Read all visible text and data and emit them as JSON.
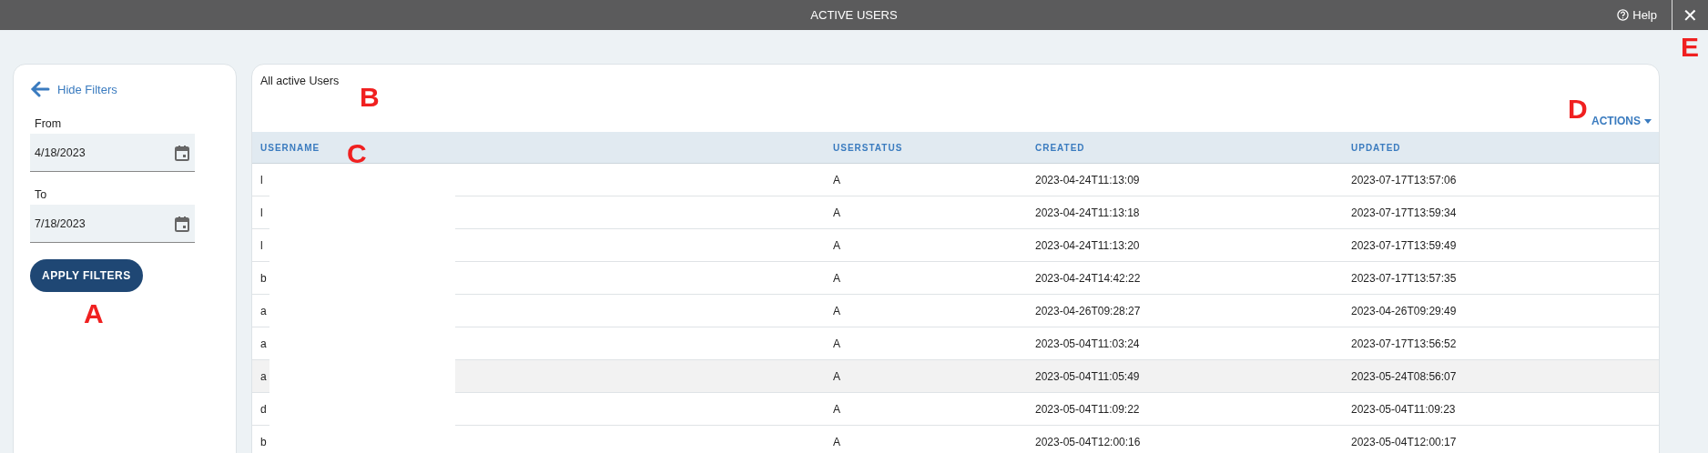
{
  "window": {
    "title": "ACTIVE USERS",
    "help": "Help",
    "close": "✕"
  },
  "filters": {
    "hide_link": "Hide Filters",
    "fields": [
      {
        "label": "From",
        "value": "4/18/2023"
      },
      {
        "label": "To",
        "value": "7/18/2023"
      }
    ],
    "apply_button": "APPLY FILTERS"
  },
  "table": {
    "title": "All active Users",
    "actions": "ACTIONS",
    "columns": [
      "USERNAME",
      "USERSTATUS",
      "CREATED",
      "UPDATED"
    ],
    "rows": [
      {
        "cells": [
          "l",
          "A",
          "2023-04-24T11:13:09",
          "2023-07-17T13:57:06"
        ],
        "selected": false
      },
      {
        "cells": [
          "l",
          "A",
          "2023-04-24T11:13:18",
          "2023-07-17T13:59:34"
        ],
        "selected": false
      },
      {
        "cells": [
          "l",
          "A",
          "2023-04-24T11:13:20",
          "2023-07-17T13:59:49"
        ],
        "selected": false
      },
      {
        "cells": [
          "b",
          "A",
          "2023-04-24T14:42:22",
          "2023-07-17T13:57:35"
        ],
        "selected": false
      },
      {
        "cells": [
          "a",
          "A",
          "2023-04-26T09:28:27",
          "2023-04-26T09:29:49"
        ],
        "selected": false
      },
      {
        "cells": [
          "a",
          "A",
          "2023-05-04T11:03:24",
          "2023-07-17T13:56:52"
        ],
        "selected": false
      },
      {
        "cells": [
          "a",
          "A",
          "2023-05-04T11:05:49",
          "2023-05-24T08:56:07"
        ],
        "selected": true
      },
      {
        "cells": [
          "d",
          "A",
          "2023-05-04T11:09:22",
          "2023-05-04T11:09:23"
        ],
        "selected": false
      },
      {
        "cells": [
          "b",
          "A",
          "2023-05-04T12:00:16",
          "2023-05-04T12:00:17"
        ],
        "selected": false
      }
    ]
  },
  "annotations": [
    "A",
    "B",
    "C",
    "D",
    "E"
  ]
}
